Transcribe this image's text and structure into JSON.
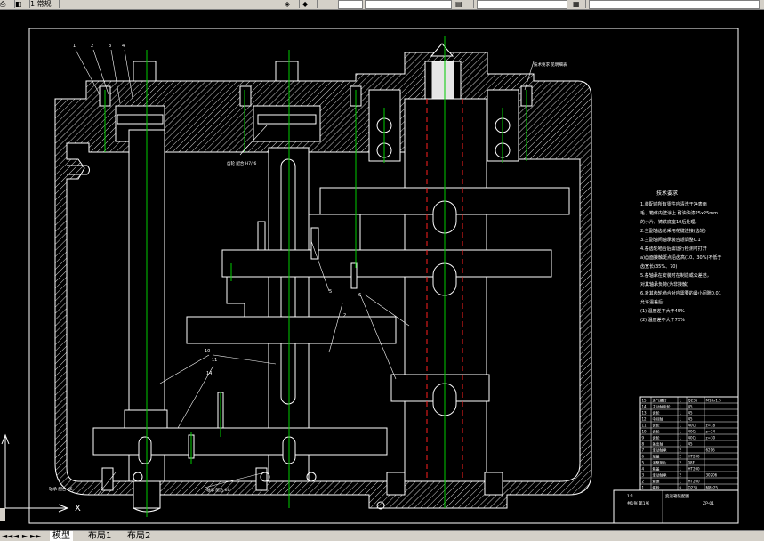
{
  "toolbar": {
    "left_label": "1 常规",
    "layer_field": "",
    "style_field": "",
    "icons": [
      "plot-icon",
      "layers-icon",
      "properties-icon",
      "match-icon",
      "pan-icon"
    ]
  },
  "drawing": {
    "tech_title": "技术要求",
    "tech_lines": [
      "1.装配前所有零件应清洗干净表面",
      "毛、箱体内壁涂上 耐油油漆25x25mm",
      "的小片。铸铁底座10后处理。",
      "2.主副轴齿轮采用花键连接(齿轮)",
      "3.主副轴间轴承装合适调整0.1",
      "4.各齿轮啮合后需运行检测可打开",
      "a)齿面接触斑点沿齿高(10、30%)不低于",
      "齿宽长(35%、70)",
      "5.各轴承在安装时在制造或公差范，",
      "对其轴承负荷(为非接触)",
      "6.对其齿轮啮合对应需要的最小间隙0.01",
      "允许温差后:",
      "(1) 温度差不大于45%",
      "(2) 温度差不大于75%"
    ],
    "part_labels": [
      "1",
      "2",
      "3",
      "4"
    ],
    "callouts": [
      "1",
      "2",
      "3",
      "4",
      "5",
      "6",
      "7",
      "8",
      "9",
      "10",
      "11",
      "12",
      "13",
      "14"
    ],
    "annotation_top": "技术要求 见明细表",
    "annotation_left": "齿轮 配合 H7/r6",
    "annotation_bottom_left": "轴承 配合 K6",
    "annotation_bottom_mid": "轴承 配合 k6",
    "table_rows": [
      {
        "no": "15",
        "name": "通气螺钉",
        "qty": "1",
        "mat": "Q235",
        "note": "M18x1.5"
      },
      {
        "no": "14",
        "name": "主动轴齿轮",
        "qty": "1",
        "mat": "45",
        "note": ""
      },
      {
        "no": "13",
        "name": "齿轮",
        "qty": "1",
        "mat": "45",
        "note": ""
      },
      {
        "no": "12",
        "name": "中间轴",
        "qty": "1",
        "mat": "45",
        "note": ""
      },
      {
        "no": "11",
        "name": "齿轮",
        "qty": "1",
        "mat": "40Cr",
        "note": "z=18"
      },
      {
        "no": "10",
        "name": "齿轮",
        "qty": "1",
        "mat": "40Cr",
        "note": "z=24"
      },
      {
        "no": "9",
        "name": "齿轮",
        "qty": "1",
        "mat": "40Cr",
        "note": "z=30"
      },
      {
        "no": "8",
        "name": "输出轴",
        "qty": "1",
        "mat": "45",
        "note": ""
      },
      {
        "no": "7",
        "name": "滚动轴承",
        "qty": "2",
        "mat": "",
        "note": "6206"
      },
      {
        "no": "6",
        "name": "端盖",
        "qty": "2",
        "mat": "HT200",
        "note": ""
      },
      {
        "no": "5",
        "name": "调整垫片",
        "qty": "2",
        "mat": "08F",
        "note": ""
      },
      {
        "no": "4",
        "name": "箱盖",
        "qty": "1",
        "mat": "HT200",
        "note": ""
      },
      {
        "no": "3",
        "name": "滚动轴承",
        "qty": "2",
        "mat": "",
        "note": "30206"
      },
      {
        "no": "2",
        "name": "箱体",
        "qty": "1",
        "mat": "HT200",
        "note": ""
      },
      {
        "no": "1",
        "name": "螺栓",
        "qty": "6",
        "mat": "Q235",
        "note": "M8x25"
      }
    ],
    "title_block": {
      "title": "变速箱装配图",
      "scale": "1:1",
      "sheet": "共1张 第1张",
      "drawing_no": "ZP-01"
    }
  },
  "layout_tabs": {
    "items": [
      {
        "label": "模型"
      },
      {
        "label": "布局1"
      },
      {
        "label": "布局2"
      }
    ],
    "nav_arrows": [
      "◄◄",
      "◄",
      "►",
      "►►"
    ]
  },
  "colors": {
    "background": "#000000",
    "outline": "#ffffff",
    "centerline": "#00cc00",
    "hidden": "#ff0000",
    "hatch": "#cccccc"
  }
}
